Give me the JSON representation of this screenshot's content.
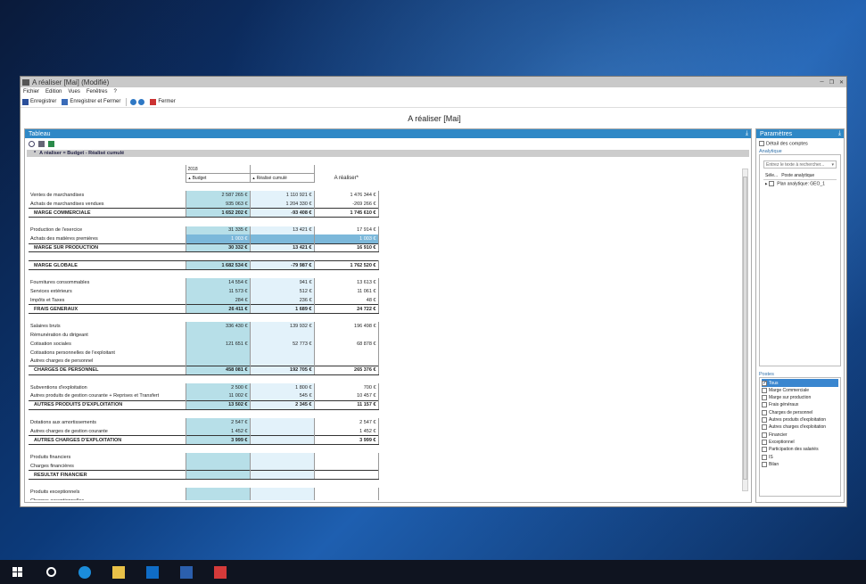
{
  "window": {
    "title": "A réaliser [Mai] (Modifié)",
    "menu": [
      "Fichier",
      "Edition",
      "Vues",
      "Fenêtres",
      "?"
    ],
    "toolbar": {
      "save": "Enregistrer",
      "save_close": "Enregistrer et Fermer",
      "close": "Fermer"
    },
    "heading": "A réaliser [Mai]"
  },
  "tableau": {
    "title": "Tableau",
    "breadcrumb": "A réaliser = Budget - Réalisé cumulé",
    "year": "2018",
    "col_budget": "Budget",
    "col_realise": "Réalisé cumulé",
    "col_areal": "A réaliser*",
    "rows": [
      {
        "type": "gap"
      },
      {
        "label": "Ventes de marchandises",
        "b": "2 587 265 €",
        "r": "1 110 921 €",
        "a": "1 476 344 €"
      },
      {
        "label": "Achats de marchandises vendues",
        "b": "935 063 €",
        "r": "1 204 330 €",
        "a": "-269 266 €"
      },
      {
        "type": "total",
        "label": "MARGE COMMERCIALE",
        "b": "1 652 202 €",
        "r": "-93 408 €",
        "a": "1 745 610 €"
      },
      {
        "type": "gap"
      },
      {
        "label": "Production de l'exercice",
        "b": "31 335 €",
        "r": "13 421 €",
        "a": "17 914 €"
      },
      {
        "type": "sel",
        "label": "Achats des matières premières",
        "b": "1 003 €",
        "r": "",
        "a": "1 003 €"
      },
      {
        "type": "total",
        "label": "MARGE SUR PRODUCTION",
        "b": "30 332 €",
        "r": "13 421 €",
        "a": "16 910 €"
      },
      {
        "type": "gap"
      },
      {
        "type": "total",
        "label": "MARGE GLOBALE",
        "b": "1 682 534 €",
        "r": "-79 987 €",
        "a": "1 762 520 €"
      },
      {
        "type": "gap"
      },
      {
        "label": "Fournitures consommables",
        "b": "14 554 €",
        "r": "941 €",
        "a": "13 613 €"
      },
      {
        "label": "Services extérieurs",
        "b": "11 573 €",
        "r": "512 €",
        "a": "11 061 €"
      },
      {
        "label": "Impôts et Taxes",
        "b": "284 €",
        "r": "236 €",
        "a": "48 €"
      },
      {
        "type": "total",
        "label": "FRAIS GENERAUX",
        "b": "26 411 €",
        "r": "1 689 €",
        "a": "24 722 €"
      },
      {
        "type": "gap"
      },
      {
        "label": "Salaires bruts",
        "b": "336 430 €",
        "r": "139 932 €",
        "a": "196 498 €"
      },
      {
        "label": "Rémunération du dirigeant",
        "b": "",
        "r": "",
        "a": ""
      },
      {
        "label": "Cotisation sociales",
        "b": "121 651 €",
        "r": "52 773 €",
        "a": "68 878 €"
      },
      {
        "label": "Cotisations personnelles de l'exploitant",
        "b": "",
        "r": "",
        "a": ""
      },
      {
        "label": "Autres charges de personnel",
        "b": "",
        "r": "",
        "a": ""
      },
      {
        "type": "total",
        "label": "CHARGES DE PERSONNEL",
        "b": "458 081 €",
        "r": "192 705 €",
        "a": "265 376 €"
      },
      {
        "type": "gap"
      },
      {
        "label": "Subventions d'exploitation",
        "b": "2 500 €",
        "r": "1 800 €",
        "a": "700 €"
      },
      {
        "label": "Autres produits de gestion courante + Reprises et Transfert",
        "b": "11 002 €",
        "r": "545 €",
        "a": "10 457 €"
      },
      {
        "type": "total",
        "label": "AUTRES PRODUITS D'EXPLOITATION",
        "b": "13 502 €",
        "r": "2 345 €",
        "a": "11 157 €"
      },
      {
        "type": "gap"
      },
      {
        "label": "Dotations aux amortissements",
        "b": "2 547 €",
        "r": "",
        "a": "2 547 €"
      },
      {
        "label": "Autres charges de gestion courante",
        "b": "1 452 €",
        "r": "",
        "a": "1 452 €"
      },
      {
        "type": "total",
        "label": "AUTRES CHARGES D'EXPLOITATION",
        "b": "3 999 €",
        "r": "",
        "a": "3 999 €"
      },
      {
        "type": "gap"
      },
      {
        "label": "Produits financiers",
        "b": "",
        "r": "",
        "a": ""
      },
      {
        "label": "Charges financières",
        "b": "",
        "r": "",
        "a": ""
      },
      {
        "type": "total",
        "label": "RESULTAT FINANCIER",
        "b": "",
        "r": "",
        "a": ""
      },
      {
        "type": "gap"
      },
      {
        "label": "Produits exceptionnels",
        "b": "",
        "r": "",
        "a": ""
      },
      {
        "label": "Charges exceptionnelles",
        "b": "",
        "r": "",
        "a": ""
      }
    ]
  },
  "params": {
    "title": "Paramètres",
    "detail_comptes": "Détail des comptes",
    "analytique_label": "Analytique",
    "search_placeholder": "Entrez le texte à rechercher...",
    "col_sel": "Séle...",
    "col_poste": "Poste analytique",
    "plan": "Plan analytique: GEO_1",
    "postes_label": "Postes",
    "postes": [
      {
        "label": "Tous",
        "checked": true,
        "selected": true
      },
      {
        "label": "Marge Commerciale"
      },
      {
        "label": "Marge sur production"
      },
      {
        "label": "Frais généraux"
      },
      {
        "label": "Charges de personnel"
      },
      {
        "label": "Autres produits d'exploitation"
      },
      {
        "label": "Autres charges d'exploitation"
      },
      {
        "label": "Financier"
      },
      {
        "label": "Exceptionnel"
      },
      {
        "label": "Participation des salariés"
      },
      {
        "label": "IS"
      },
      {
        "label": "Bilan"
      }
    ]
  },
  "colors": {
    "panel_head": "#2f88c6",
    "budget_col": "#b7dfe8",
    "realise_col": "#e3f2fa"
  }
}
